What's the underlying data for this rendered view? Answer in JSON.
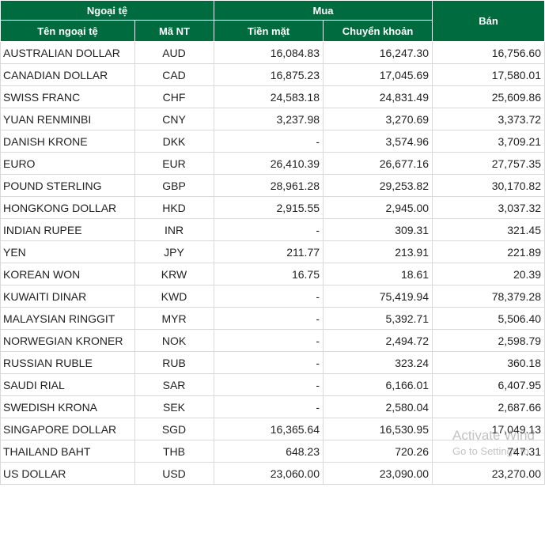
{
  "header": {
    "group_currency": "Ngoại tệ",
    "group_buy": "Mua",
    "sell": "Bán",
    "col_name": "Tên ngoại tệ",
    "col_code": "Mã NT",
    "col_cash": "Tiền mặt",
    "col_transfer": "Chuyển khoản"
  },
  "rows": [
    {
      "name": "AUSTRALIAN DOLLAR",
      "code": "AUD",
      "cash": "16,084.83",
      "transfer": "16,247.30",
      "sell": "16,756.60"
    },
    {
      "name": "CANADIAN DOLLAR",
      "code": "CAD",
      "cash": "16,875.23",
      "transfer": "17,045.69",
      "sell": "17,580.01"
    },
    {
      "name": "SWISS FRANC",
      "code": "CHF",
      "cash": "24,583.18",
      "transfer": "24,831.49",
      "sell": "25,609.86"
    },
    {
      "name": "YUAN RENMINBI",
      "code": "CNY",
      "cash": "3,237.98",
      "transfer": "3,270.69",
      "sell": "3,373.72"
    },
    {
      "name": "DANISH KRONE",
      "code": "DKK",
      "cash": "-",
      "transfer": "3,574.96",
      "sell": "3,709.21"
    },
    {
      "name": "EURO",
      "code": "EUR",
      "cash": "26,410.39",
      "transfer": "26,677.16",
      "sell": "27,757.35"
    },
    {
      "name": "POUND STERLING",
      "code": "GBP",
      "cash": "28,961.28",
      "transfer": "29,253.82",
      "sell": "30,170.82"
    },
    {
      "name": "HONGKONG DOLLAR",
      "code": "HKD",
      "cash": "2,915.55",
      "transfer": "2,945.00",
      "sell": "3,037.32"
    },
    {
      "name": "INDIAN RUPEE",
      "code": "INR",
      "cash": "-",
      "transfer": "309.31",
      "sell": "321.45"
    },
    {
      "name": "YEN",
      "code": "JPY",
      "cash": "211.77",
      "transfer": "213.91",
      "sell": "221.89"
    },
    {
      "name": "KOREAN WON",
      "code": "KRW",
      "cash": "16.75",
      "transfer": "18.61",
      "sell": "20.39"
    },
    {
      "name": "KUWAITI DINAR",
      "code": "KWD",
      "cash": "-",
      "transfer": "75,419.94",
      "sell": "78,379.28"
    },
    {
      "name": "MALAYSIAN RINGGIT",
      "code": "MYR",
      "cash": "-",
      "transfer": "5,392.71",
      "sell": "5,506.40"
    },
    {
      "name": "NORWEGIAN KRONER",
      "code": "NOK",
      "cash": "-",
      "transfer": "2,494.72",
      "sell": "2,598.79"
    },
    {
      "name": "RUSSIAN RUBLE",
      "code": "RUB",
      "cash": "-",
      "transfer": "323.24",
      "sell": "360.18"
    },
    {
      "name": "SAUDI RIAL",
      "code": "SAR",
      "cash": "-",
      "transfer": "6,166.01",
      "sell": "6,407.95"
    },
    {
      "name": "SWEDISH KRONA",
      "code": "SEK",
      "cash": "-",
      "transfer": "2,580.04",
      "sell": "2,687.66"
    },
    {
      "name": "SINGAPORE DOLLAR",
      "code": "SGD",
      "cash": "16,365.64",
      "transfer": "16,530.95",
      "sell": "17,049.13"
    },
    {
      "name": "THAILAND BAHT",
      "code": "THB",
      "cash": "648.23",
      "transfer": "720.26",
      "sell": "747.31"
    },
    {
      "name": "US DOLLAR",
      "code": "USD",
      "cash": "23,060.00",
      "transfer": "23,090.00",
      "sell": "23,270.00"
    }
  ],
  "watermark": {
    "line1": "Activate Wind",
    "line2": "Go to Settings to"
  }
}
